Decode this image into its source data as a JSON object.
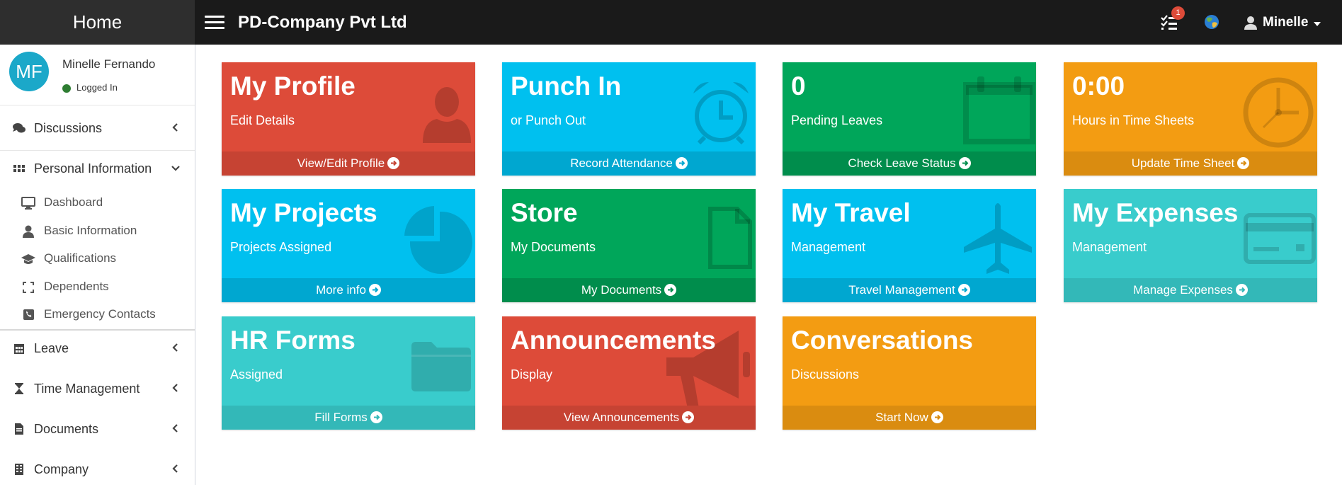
{
  "app": {
    "brand": "Home",
    "company": "PD-Company Pvt Ltd"
  },
  "topbar": {
    "tasks_badge": "1",
    "user": "Minelle"
  },
  "user_panel": {
    "initials": "MF",
    "name": "Minelle Fernando",
    "status": "Logged In"
  },
  "sidebar": {
    "items": [
      {
        "label": "Discussions",
        "icon": "comments-icon"
      },
      {
        "label": "Personal Information",
        "icon": "grid-icon"
      },
      {
        "label": "Leave",
        "icon": "calendar-icon"
      },
      {
        "label": "Time Management",
        "icon": "hourglass-icon"
      },
      {
        "label": "Documents",
        "icon": "file-icon"
      },
      {
        "label": "Company",
        "icon": "building-icon"
      }
    ],
    "sub_items": [
      {
        "label": "Dashboard",
        "icon": "desktop-icon"
      },
      {
        "label": "Basic Information",
        "icon": "user-icon"
      },
      {
        "label": "Qualifications",
        "icon": "graduation-cap-icon"
      },
      {
        "label": "Dependents",
        "icon": "expand-icon"
      },
      {
        "label": "Emergency Contacts",
        "icon": "phone-square-icon"
      }
    ]
  },
  "tiles": [
    {
      "title": "My Profile",
      "subtitle": "Edit Details",
      "footer": "View/Edit Profile",
      "color": "#dd4b39",
      "icon": "user-icon"
    },
    {
      "title": "Punch In",
      "subtitle": "or Punch Out",
      "footer": "Record Attendance",
      "color": "#00c0ef",
      "icon": "alarm-clock-icon"
    },
    {
      "title": "0",
      "subtitle": "Pending Leaves",
      "footer": "Check Leave Status",
      "color": "#00a65a",
      "icon": "calendar-icon"
    },
    {
      "title": "0:00",
      "subtitle": "Hours in Time Sheets",
      "footer": "Update Time Sheet",
      "color": "#f39c12",
      "icon": "clock-icon"
    },
    {
      "title": "My Projects",
      "subtitle": "Projects Assigned",
      "footer": "More info",
      "color": "#00c0ef",
      "icon": "pie-chart-icon"
    },
    {
      "title": "Store",
      "subtitle": "My Documents",
      "footer": "My Documents",
      "color": "#00a65a",
      "icon": "file-icon"
    },
    {
      "title": "My Travel",
      "subtitle": "Management",
      "footer": "Travel Management",
      "color": "#00c0ef",
      "icon": "plane-icon"
    },
    {
      "title": "My Expenses",
      "subtitle": "Management",
      "footer": "Manage Expenses",
      "color": "#39cccc",
      "icon": "credit-card-icon"
    },
    {
      "title": "HR Forms",
      "subtitle": "Assigned",
      "footer": "Fill Forms",
      "color": "#39cccc",
      "icon": "folder-icon"
    },
    {
      "title": "Announcements",
      "subtitle": "Display",
      "footer": "View Announcements",
      "color": "#dd4b39",
      "icon": "bullhorn-icon"
    },
    {
      "title": "Conversations",
      "subtitle": "Discussions",
      "footer": "Start Now",
      "color": "#f39c12",
      "icon": ""
    }
  ]
}
